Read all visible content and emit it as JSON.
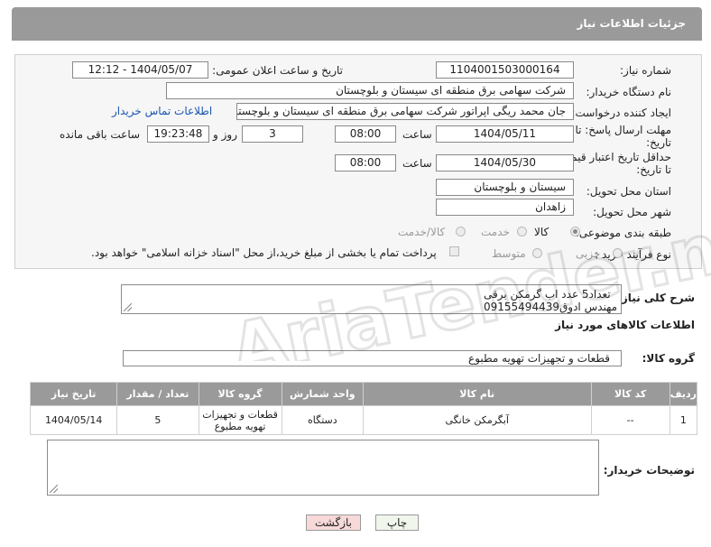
{
  "header": {
    "title": "جزئیات اطلاعات نیاز"
  },
  "form": {
    "need_number_label": "شماره نیاز:",
    "need_number": "1104001503000164",
    "announce_label": "تاریخ و ساعت اعلان عمومی:",
    "announce_value": "1404/05/07 - 12:12",
    "buyer_org_label": "نام دستگاه خریدار:",
    "buyer_org": "شرکت سهامی برق منطقه ای سیستان و بلوچستان",
    "creator_label": "ایجاد کننده درخواست:",
    "creator": "جان محمد ریگی اپراتور شرکت سهامی برق منطقه ای سیستان و بلوچستان",
    "contact_link": "اطلاعات تماس خریدار",
    "deadline_label_1": "مهلت ارسال پاسخ: تا",
    "deadline_label_2": "تاریخ:",
    "deadline_date": "1404/05/11",
    "time_label": "ساعت",
    "deadline_time": "08:00",
    "days_value": "3",
    "days_label": "روز و",
    "remaining_time": "19:23:48",
    "remaining_label": "ساعت باقی مانده",
    "validity_label_1": "حداقل تاریخ اعتبار قیمت:",
    "validity_label_2": "تا تاریخ:",
    "validity_date": "1404/05/30",
    "validity_time": "08:00",
    "province_label": "استان محل تحویل:",
    "province": "سیستان و بلوچستان",
    "city_label": "شهر محل تحویل:",
    "city": "زاهدان",
    "category_label": "طبقه بندی موضوعی:",
    "category_goods": "کالا",
    "category_service": "خدمت",
    "category_both": "کالا/خدمت",
    "process_label": "نوع فرآیند خرید :",
    "process_partial": "جزیی",
    "process_medium": "متوسط",
    "payment_note": "پرداخت تمام یا بخشی از مبلغ خرید،از محل \"اسناد خزانه اسلامی\" خواهد بود."
  },
  "description": {
    "label": "شرح کلی نیاز:",
    "line1": "تعداد5 عدد اب گرمکن برقی",
    "line2": "مهندس ادوق09155494439"
  },
  "goods_section": {
    "title": "اطلاعات کالاهای مورد نیاز",
    "group_label": "گروه کالا:",
    "group_value": "قطعات و تجهیزات تهویه مطبوع"
  },
  "table": {
    "headers": [
      "ردیف",
      "کد کالا",
      "نام کالا",
      "واحد شمارش",
      "گروه کالا",
      "تعداد / مقدار",
      "تاریخ نیاز"
    ],
    "rows": [
      {
        "row": "1",
        "code": "--",
        "name": "آبگرمکن خانگی",
        "unit": "دستگاه",
        "group_1": "قطعات و تجهیزات",
        "group_2": "تهویه مطبوع",
        "qty": "5",
        "date": "1404/05/14"
      }
    ]
  },
  "buyer_notes": {
    "label": "توضیحات خریدار:",
    "value": ""
  },
  "buttons": {
    "print": "چاپ",
    "back": "بازگشت"
  },
  "watermark": {
    "text": "AriaTender.neT"
  },
  "colors": {
    "header_bg": "#9a9a9a",
    "link": "#1a55b0",
    "back_button_bg": "#f7d9d9"
  }
}
